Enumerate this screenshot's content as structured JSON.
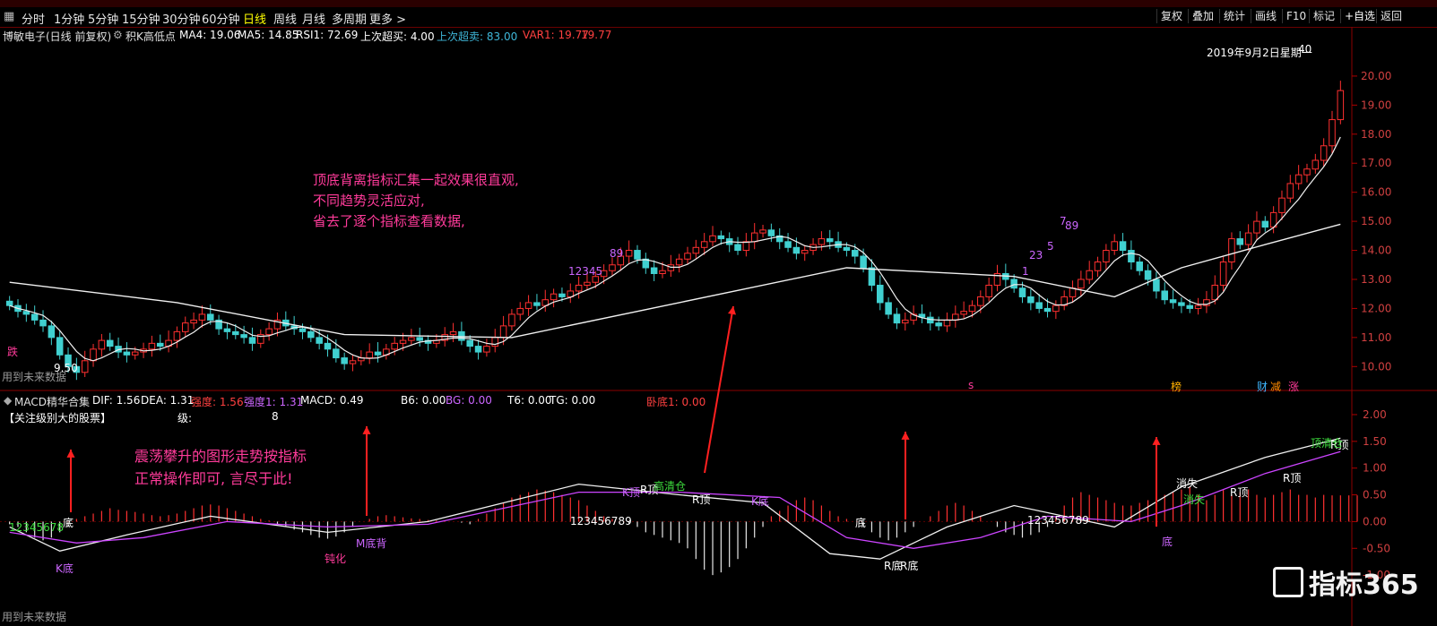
{
  "toolbar": {
    "timeframes": [
      "分时",
      "1分钟",
      "5分钟",
      "15分钟",
      "30分钟",
      "60分钟",
      "日线",
      "周线",
      "月线",
      "多周期",
      "更多 >"
    ],
    "active": "日线",
    "buttons": [
      "复权",
      "叠加",
      "统计",
      "画线",
      "F10",
      "标记",
      "+自选",
      "返回"
    ]
  },
  "header": {
    "stock": "博敏电子(日线 前复权)",
    "indicator": "积K高低点",
    "ma4": "MA4: 19.06",
    "ma5": "MA5: 14.85",
    "rsi1": "RSI1: 72.69",
    "last_over": "上次超买: 4.00",
    "last_super": "上次超卖: 83.00",
    "var1": "VAR1: 19.77",
    "extra": "19.77",
    "date_label": "2019年9月2日星期一",
    "high_label": "40",
    "low_label": "9.50",
    "future_data": "用到未来数据",
    "markers": {
      "die": "跌",
      "s": "s",
      "bang": "榜",
      "cai": "财",
      "jian": "减",
      "zhang": "涨"
    },
    "digits": [
      "12345",
      "89",
      "7",
      "89",
      "23",
      "5",
      "1"
    ]
  },
  "macd_header": {
    "name": "MACD精华合集",
    "dif": "DIF: 1.56",
    "dea": "DEA: 1.31",
    "strength": "强度: 1.56",
    "strength1": "强度1: 1.31",
    "macd": "MACD: 0.49",
    "b6": "B6: 0.00",
    "bg": "BG: 0.00",
    "t6": "T6: 0.00",
    "tg": "TG: 0.00",
    "kd": "卧底1: 0.00",
    "watch": "【关注级别大的股票】",
    "level_label": "级:",
    "level": "8",
    "future_data": "用到未来数据"
  },
  "macd_labels": {
    "k_di": "K底",
    "di": "底",
    "dunhua": "钝化",
    "m_di_bei": "M底背",
    "k_ding": "K顶",
    "r_ding": "R顶",
    "qing_cang": "高清仓",
    "k_di2": "K底",
    "seq": "123456789",
    "di2": "底",
    "r_di": "R底",
    "r_di2": "R底",
    "seq2": "123456789",
    "xiaoshi": "消失",
    "dunhua2": "钝化",
    "di3": "底",
    "r_ding2": "R顶",
    "r_ding3": "R顶",
    "r_ding4": "R顶",
    "ding_qing": "顶清仓",
    "seq_left": "12345678",
    "seq_left2": "45"
  },
  "annotations": {
    "main": [
      "顶底背离指标汇集一起效果很直观,",
      "不同趋势灵活应对,",
      "省去了逐个指标查看数据,"
    ],
    "macd": [
      "震荡攀升的图形走势按指标",
      "正常操作即可, 言尽于此!"
    ]
  },
  "watermark": "指标365",
  "chart_data": [
    {
      "type": "candlestick",
      "title": "博敏电子(日线 前复权)",
      "y_ticks": [
        10.0,
        11.0,
        12.0,
        13.0,
        14.0,
        15.0,
        16.0,
        17.0,
        18.0,
        19.0,
        20.0
      ],
      "ylim": [
        9.3,
        21.2
      ],
      "n_bars": 160,
      "closes": [
        12.1,
        11.9,
        11.8,
        11.6,
        11.4,
        11.0,
        10.4,
        10.0,
        9.8,
        10.2,
        10.6,
        10.9,
        10.7,
        10.5,
        10.4,
        10.5,
        10.6,
        10.8,
        10.7,
        10.9,
        11.2,
        11.5,
        11.6,
        11.8,
        11.6,
        11.3,
        11.2,
        11.1,
        11.0,
        10.8,
        11.1,
        11.3,
        11.6,
        11.4,
        11.3,
        11.2,
        11.0,
        10.8,
        10.6,
        10.3,
        10.1,
        10.2,
        10.3,
        10.5,
        10.4,
        10.6,
        10.8,
        10.9,
        11.0,
        10.9,
        10.8,
        10.9,
        11.1,
        11.2,
        10.9,
        10.7,
        10.5,
        10.7,
        11.0,
        11.4,
        11.8,
        12.0,
        12.2,
        12.1,
        12.3,
        12.5,
        12.4,
        12.6,
        12.8,
        12.9,
        13.1,
        13.3,
        13.5,
        13.8,
        14.0,
        13.7,
        13.4,
        13.2,
        13.3,
        13.5,
        13.7,
        13.9,
        14.1,
        14.3,
        14.5,
        14.4,
        14.2,
        14.0,
        14.3,
        14.6,
        14.7,
        14.5,
        14.3,
        14.1,
        13.9,
        14.0,
        14.2,
        14.4,
        14.3,
        14.1,
        14.0,
        13.8,
        13.4,
        12.8,
        12.2,
        11.8,
        11.5,
        11.6,
        11.8,
        11.7,
        11.5,
        11.4,
        11.6,
        11.8,
        11.9,
        12.1,
        12.4,
        12.8,
        13.2,
        13.0,
        12.7,
        12.4,
        12.2,
        12.0,
        11.9,
        12.1,
        12.4,
        12.7,
        13.0,
        13.3,
        13.6,
        14.0,
        14.3,
        14.0,
        13.6,
        13.3,
        13.0,
        12.6,
        12.3,
        12.2,
        12.1,
        12.0,
        12.1,
        12.3,
        12.8,
        13.6,
        14.4,
        14.2,
        14.6,
        15.0,
        14.8,
        15.3,
        15.8,
        16.3,
        16.6,
        16.8,
        17.1,
        17.6,
        18.5,
        19.5,
        19.0,
        19.8,
        20.0,
        19.77
      ],
      "ma_short": "MA4 (white line, follows closes)",
      "ma_long_points": [
        [
          0,
          12.9
        ],
        [
          20,
          12.2
        ],
        [
          40,
          11.1
        ],
        [
          60,
          11.0
        ],
        [
          80,
          12.2
        ],
        [
          100,
          13.4
        ],
        [
          120,
          13.1
        ],
        [
          132,
          12.4
        ],
        [
          140,
          13.4
        ],
        [
          150,
          14.2
        ],
        [
          160,
          14.9
        ]
      ]
    },
    {
      "type": "bar",
      "title": "MACD精华合集",
      "y_ticks": [
        -1.0,
        -0.5,
        0.0,
        0.5,
        1.0,
        1.5,
        2.0
      ],
      "ylim": [
        -1.5,
        2.15
      ],
      "n_bars": 160,
      "macd_hist": [
        -0.05,
        -0.1,
        -0.2,
        -0.3,
        -0.35,
        -0.3,
        -0.2,
        -0.1,
        0.05,
        0.1,
        0.15,
        0.2,
        0.25,
        0.22,
        0.2,
        0.18,
        0.15,
        0.12,
        0.1,
        0.12,
        0.15,
        0.2,
        0.25,
        0.3,
        0.32,
        0.3,
        0.25,
        0.2,
        0.15,
        0.1,
        0.05,
        0.02,
        -0.05,
        -0.1,
        -0.15,
        -0.2,
        -0.25,
        -0.3,
        -0.32,
        -0.28,
        -0.2,
        -0.1,
        0.0,
        0.05,
        0.1,
        0.12,
        0.1,
        0.08,
        0.06,
        0.05,
        0.03,
        0.02,
        0.01,
        0.0,
        -0.02,
        -0.05,
        0.05,
        0.15,
        0.25,
        0.35,
        0.45,
        0.5,
        0.55,
        0.6,
        0.58,
        0.55,
        0.5,
        0.45,
        0.4,
        0.3,
        0.2,
        0.1,
        0.05,
        0.0,
        -0.05,
        -0.1,
        -0.2,
        -0.25,
        -0.3,
        -0.35,
        -0.4,
        -0.5,
        -0.7,
        -0.9,
        -1.0,
        -0.95,
        -0.85,
        -0.7,
        -0.5,
        -0.3,
        -0.1,
        0.1,
        0.2,
        0.3,
        0.4,
        0.45,
        0.4,
        0.3,
        0.2,
        0.1,
        0.05,
        0.0,
        -0.1,
        -0.2,
        -0.3,
        -0.35,
        -0.3,
        -0.2,
        -0.1,
        0.0,
        0.1,
        0.2,
        0.3,
        0.35,
        0.3,
        0.2,
        0.1,
        0.0,
        -0.1,
        -0.2,
        -0.25,
        -0.3,
        -0.25,
        -0.2,
        -0.1,
        0.1,
        0.3,
        0.45,
        0.55,
        0.5,
        0.45,
        0.4,
        0.35,
        0.3,
        0.3,
        0.35,
        0.4,
        0.45,
        0.5,
        0.55,
        0.6,
        0.65,
        0.5,
        0.4,
        0.5,
        0.6,
        0.5,
        0.55,
        0.6,
        0.5,
        0.45,
        0.5,
        0.55,
        0.6,
        0.5,
        0.5,
        0.45,
        0.5,
        0.49,
        0.49,
        0.49,
        0.49
      ],
      "dif_points": [
        [
          0,
          -0.1
        ],
        [
          6,
          -0.55
        ],
        [
          14,
          -0.25
        ],
        [
          24,
          0.1
        ],
        [
          38,
          -0.2
        ],
        [
          50,
          0.0
        ],
        [
          68,
          0.7
        ],
        [
          80,
          0.5
        ],
        [
          90,
          0.35
        ],
        [
          98,
          -0.6
        ],
        [
          104,
          -0.7
        ],
        [
          112,
          -0.1
        ],
        [
          120,
          0.3
        ],
        [
          132,
          -0.1
        ],
        [
          140,
          0.65
        ],
        [
          150,
          1.2
        ],
        [
          160,
          1.56
        ]
      ],
      "dea_points": [
        [
          0,
          -0.2
        ],
        [
          8,
          -0.4
        ],
        [
          16,
          -0.3
        ],
        [
          26,
          0.0
        ],
        [
          38,
          -0.1
        ],
        [
          50,
          -0.05
        ],
        [
          68,
          0.55
        ],
        [
          80,
          0.55
        ],
        [
          92,
          0.45
        ],
        [
          100,
          -0.3
        ],
        [
          108,
          -0.5
        ],
        [
          116,
          -0.3
        ],
        [
          124,
          0.1
        ],
        [
          134,
          0.0
        ],
        [
          140,
          0.3
        ],
        [
          150,
          0.9
        ],
        [
          160,
          1.31
        ]
      ]
    }
  ]
}
